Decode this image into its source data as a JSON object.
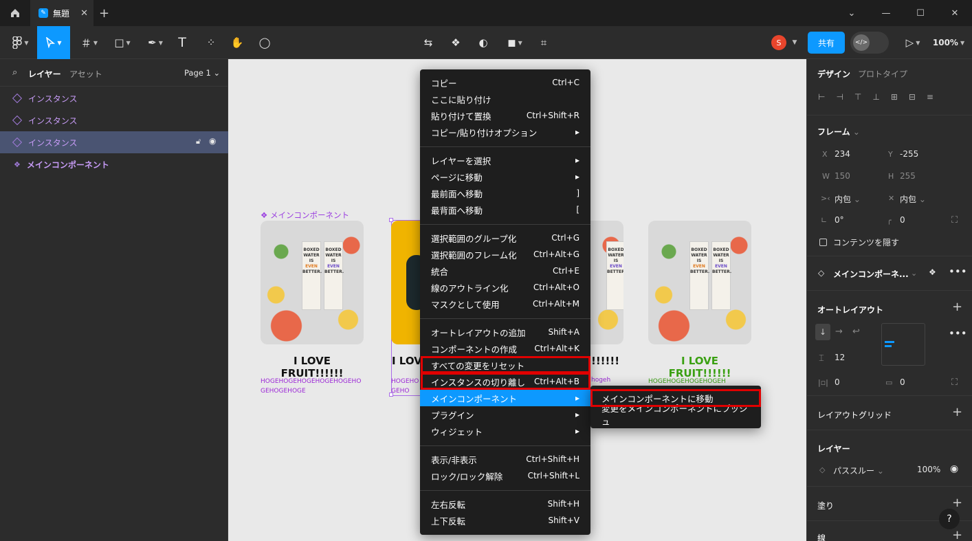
{
  "titlebar": {
    "tab_title": "無題"
  },
  "toolbar": {
    "share_label": "共有",
    "zoom": "100%",
    "avatar_initial": "S"
  },
  "left_panel": {
    "tabs": {
      "layers": "レイヤー",
      "assets": "アセット",
      "page": "Page 1"
    },
    "layers": [
      {
        "label": "インスタンス"
      },
      {
        "label": "インスタンス"
      },
      {
        "label": "インスタンス"
      },
      {
        "label": "メインコンポーネント"
      }
    ]
  },
  "canvas": {
    "component_label": "メインコンポーネント",
    "cards": [
      {
        "title": "I LOVE FRUIT!!!!!!",
        "subtitle": "HOGEHOGEHOGEHOGEHOGEHOGEHOGEHOGE"
      },
      {
        "title": "I LOV",
        "subtitle": "HOGEHO GEHO"
      },
      {
        "title": "!!!!!!",
        "subtitle": "hogeh"
      },
      {
        "title": "I LOVE FRUIT!!!!!!",
        "subtitle": "HOGEHOGEHOGEHOGEH"
      }
    ],
    "carton": {
      "line1": "BOXED",
      "line2": "WATER",
      "line3": "IS",
      "even": "EVEN",
      "line5": "BETTER."
    }
  },
  "context_menu": {
    "groups": [
      [
        {
          "label": "コピー",
          "shortcut": "Ctrl+C"
        },
        {
          "label": "ここに貼り付け",
          "shortcut": ""
        },
        {
          "label": "貼り付けて置換",
          "shortcut": "Ctrl+Shift+R"
        },
        {
          "label": "コピー/貼り付けオプション",
          "shortcut": "▸"
        }
      ],
      [
        {
          "label": "レイヤーを選択",
          "shortcut": "▸"
        },
        {
          "label": "ページに移動",
          "shortcut": "▸"
        },
        {
          "label": "最前面へ移動",
          "shortcut": "]"
        },
        {
          "label": "最背面へ移動",
          "shortcut": "["
        }
      ],
      [
        {
          "label": "選択範囲のグループ化",
          "shortcut": "Ctrl+G"
        },
        {
          "label": "選択範囲のフレーム化",
          "shortcut": "Ctrl+Alt+G"
        },
        {
          "label": "統合",
          "shortcut": "Ctrl+E"
        },
        {
          "label": "線のアウトライン化",
          "shortcut": "Ctrl+Alt+O"
        },
        {
          "label": "マスクとして使用",
          "shortcut": "Ctrl+Alt+M"
        }
      ],
      [
        {
          "label": "オートレイアウトの追加",
          "shortcut": "Shift+A"
        },
        {
          "label": "コンポーネントの作成",
          "shortcut": "Ctrl+Alt+K"
        },
        {
          "label": "すべての変更をリセット",
          "shortcut": ""
        },
        {
          "label": "インスタンスの切り離し",
          "shortcut": "Ctrl+Alt+B"
        },
        {
          "label": "メインコンポーネント",
          "shortcut": "▸"
        },
        {
          "label": "プラグイン",
          "shortcut": "▸"
        },
        {
          "label": "ウィジェット",
          "shortcut": "▸"
        }
      ],
      [
        {
          "label": "表示/非表示",
          "shortcut": "Ctrl+Shift+H"
        },
        {
          "label": "ロック/ロック解除",
          "shortcut": "Ctrl+Shift+L"
        }
      ],
      [
        {
          "label": "左右反転",
          "shortcut": "Shift+H"
        },
        {
          "label": "上下反転",
          "shortcut": "Shift+V"
        }
      ]
    ],
    "submenu": [
      {
        "label": "メインコンポーネントに移動"
      },
      {
        "label": "変更をメインコンポーネントにプッシュ"
      }
    ]
  },
  "right_panel": {
    "tabs": {
      "design": "デザイン",
      "prototype": "プロトタイプ"
    },
    "frame": {
      "title": "フレーム",
      "x_label": "X",
      "x": "234",
      "y_label": "Y",
      "y": "-255",
      "w_label": "W",
      "w": "150",
      "h_label": "H",
      "h": "255",
      "hug_w": "内包",
      "hug_h": "内包",
      "rotation": "0°",
      "radius": "0",
      "clip": "コンテンツを隠す"
    },
    "component": {
      "name": "メインコンポーネ..."
    },
    "auto_layout": {
      "title": "オートレイアウト",
      "gap": "12",
      "pad_h": "0",
      "pad_v": "0"
    },
    "layout_grid": {
      "title": "レイアウトグリッド"
    },
    "layer": {
      "title": "レイヤー",
      "blend": "パススルー",
      "opacity": "100%"
    },
    "fill": {
      "title": "塗り"
    },
    "stroke": {
      "title": "線"
    }
  },
  "help": "?"
}
